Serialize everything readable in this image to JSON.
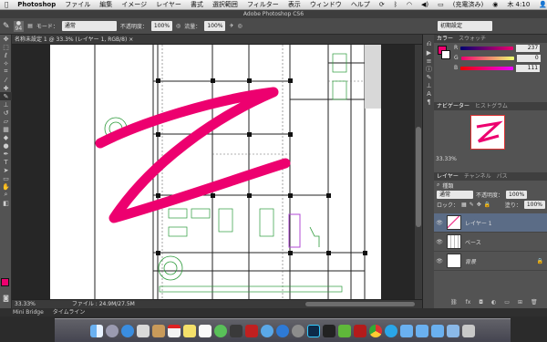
{
  "menubar": {
    "app": "Photoshop",
    "items": [
      "ファイル",
      "編集",
      "イメージ",
      "レイヤー",
      "書式",
      "選択範囲",
      "フィルター",
      "表示",
      "ウィンドウ",
      "ヘルプ"
    ],
    "battery": "(充電済み)",
    "clock": "木 4:10"
  },
  "window": {
    "title": "Adobe Photoshop CS6"
  },
  "options": {
    "brush_size": "94",
    "mode_label": "モード：",
    "mode_value": "通常",
    "opacity_label": "不透明度：",
    "opacity_value": "100%",
    "flow_label": "流量：",
    "flow_value": "100%",
    "workspace": "初期設定"
  },
  "document": {
    "tab": "名称未設定 1 @ 33.3% (レイヤー 1, RGB/8) ×"
  },
  "status": {
    "zoom": "33.33%",
    "file": "ファイル : 24.9M/27.5M"
  },
  "bottom_tabs": [
    "Mini Bridge",
    "タイムライン"
  ],
  "color_panel": {
    "tabs": [
      "カラー",
      "スウォッチ"
    ],
    "R_label": "R",
    "R": "237",
    "G_label": "G",
    "G": "0",
    "B_label": "B",
    "B": "111",
    "foreground": "#ed006f"
  },
  "navigator": {
    "tabs": [
      "ナビゲーター",
      "ヒストグラム"
    ],
    "zoom": "33.33%"
  },
  "layers_panel": {
    "tabs": [
      "レイヤー",
      "チャンネル",
      "パス"
    ],
    "kind_label": "種類",
    "blend": "通常",
    "opacity_label": "不透明度：",
    "opacity": "100%",
    "lock_label": "ロック：",
    "fill_label": "塗り：",
    "fill": "100%",
    "layers": [
      {
        "name": "レイヤー 1",
        "selected": true
      },
      {
        "name": "ベース",
        "selected": false
      },
      {
        "name": "背景",
        "selected": false
      }
    ]
  },
  "colors": {
    "accent": "#ed006f",
    "panel": "#535353",
    "selected_layer": "#5b6c86"
  }
}
